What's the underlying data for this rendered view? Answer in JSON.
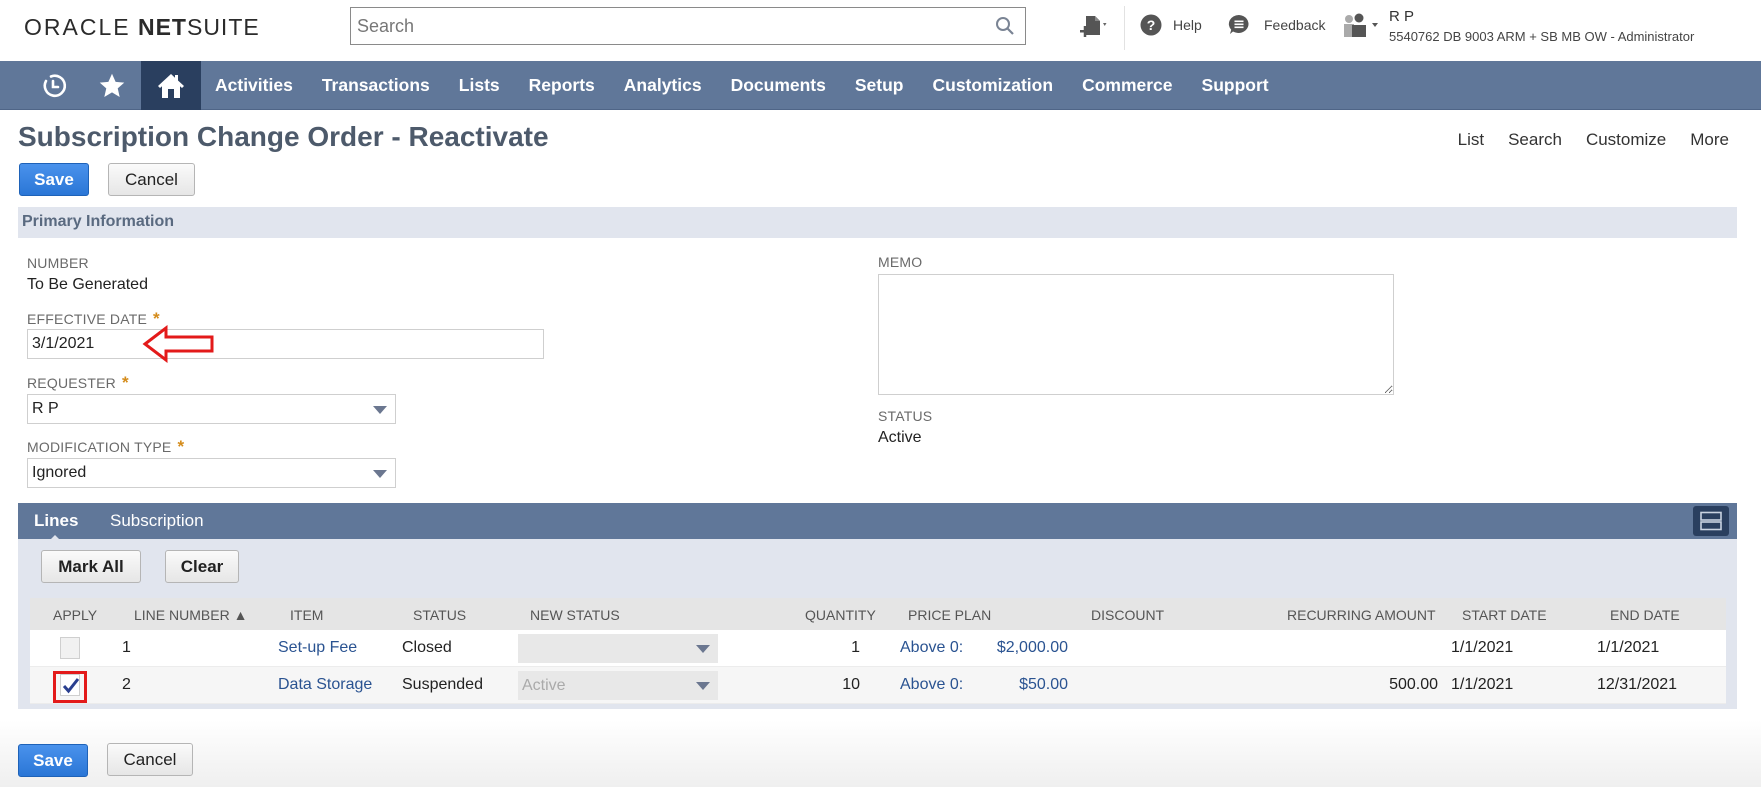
{
  "header": {
    "logo_oracle": "ORACLE",
    "logo_net": "NET",
    "logo_suite": "SUITE",
    "search_placeholder": "Search",
    "help_label": "Help",
    "feedback_label": "Feedback",
    "user_name": "R P",
    "user_role": "5540762 DB 9003 ARM + SB MB OW - Administrator"
  },
  "nav": {
    "items": [
      "Activities",
      "Transactions",
      "Lists",
      "Reports",
      "Analytics",
      "Documents",
      "Setup",
      "Customization",
      "Commerce",
      "Support"
    ]
  },
  "page": {
    "title": "Subscription Change Order - Reactivate",
    "top_links": [
      "List",
      "Search",
      "Customize",
      "More"
    ],
    "save_label": "Save",
    "cancel_label": "Cancel"
  },
  "primary": {
    "section_title": "Primary Information",
    "number_label": "NUMBER",
    "number_value": "To Be Generated",
    "effective_date_label": "EFFECTIVE DATE",
    "effective_date_value": "3/1/2021",
    "requester_label": "REQUESTER",
    "requester_value": "R P",
    "modification_type_label": "MODIFICATION TYPE",
    "modification_type_value": "Ignored",
    "memo_label": "MEMO",
    "memo_value": "",
    "status_label": "STATUS",
    "status_value": "Active",
    "required_mark": "*"
  },
  "lines": {
    "tabs": [
      "Lines",
      "Subscription"
    ],
    "mark_all_label": "Mark All",
    "clear_label": "Clear",
    "columns": [
      "APPLY",
      "LINE NUMBER ▲",
      "ITEM",
      "STATUS",
      "NEW STATUS",
      "QUANTITY",
      "PRICE PLAN",
      "DISCOUNT",
      "RECURRING AMOUNT",
      "START DATE",
      "END DATE"
    ],
    "rows": [
      {
        "apply": false,
        "line": "1",
        "item": "Set-up Fee",
        "status": "Closed",
        "new_status": "",
        "quantity": "1",
        "price_tier": "Above 0:",
        "price": "$2,000.00",
        "discount": "",
        "recurring": "",
        "start": "1/1/2021",
        "end": "1/1/2021"
      },
      {
        "apply": true,
        "line": "2",
        "item": "Data Storage",
        "status": "Suspended",
        "new_status": "Active",
        "quantity": "10",
        "price_tier": "Above 0:",
        "price": "$50.00",
        "discount": "",
        "recurring": "500.00",
        "start": "1/1/2021",
        "end": "12/31/2021"
      }
    ]
  },
  "colors": {
    "nav_bg": "#607799",
    "nav_active": "#2a3f5f",
    "primary_button": "#2f7fe0",
    "section_bg": "#e1e5ee",
    "link": "#2a5391",
    "required": "#d48b1a",
    "annotation_red": "#e31a1a"
  }
}
